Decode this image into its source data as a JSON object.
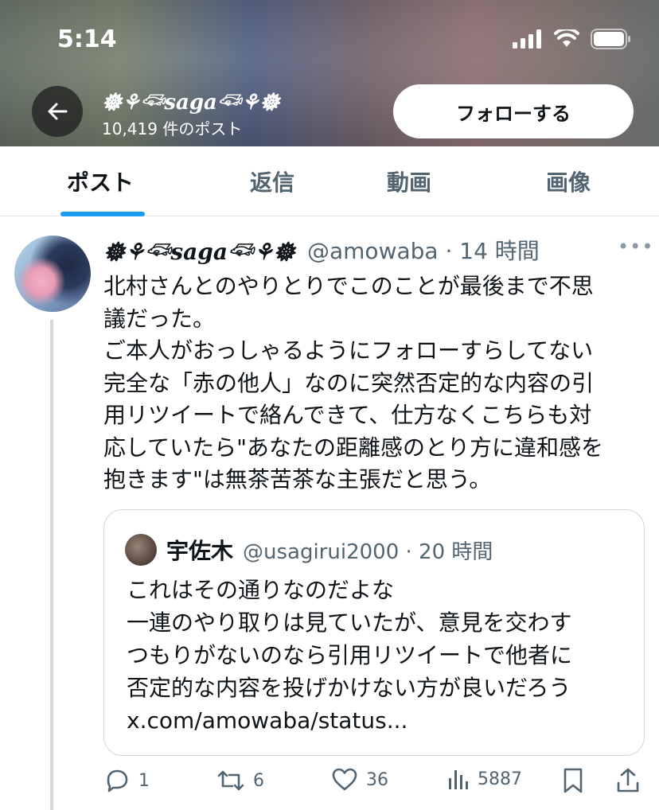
{
  "status_bar": {
    "time": "5:14"
  },
  "header": {
    "profile_name": "𖣔⚘𓆛saga𓆛⚘𖣔",
    "post_count": "10,419 件のポスト",
    "follow_label": "フォローする"
  },
  "tabs": [
    {
      "label": "ポスト",
      "active": true
    },
    {
      "label": "返信",
      "active": false
    },
    {
      "label": "動画",
      "active": false
    },
    {
      "label": "画像",
      "active": false
    }
  ],
  "tweet": {
    "name": "𖣔⚘𓆛saga𓆛⚘𖣔",
    "handle_time": "@amowaba · 14 時間",
    "more": "•••",
    "body": "北村さんとのやりとりでこのことが最後まで不思\n議だった。\nご本人がおっしゃるようにフォローすらしてない\n完全な「赤の他人」なのに突然否定的な内容の引\n用リツイートで絡んできて、仕方なくこちらも対\n応していたら\"あなたの距離感のとり方に違和感を\n抱きます\"は無茶苦茶な主張だと思う。"
  },
  "quote": {
    "name": "宇佐木",
    "handle_time": "@usagirui2000 · 20 時間",
    "body": "これはその通りなのだよな\n一連のやり取りは見ていたが、意見を交わす\nつもりがないのなら引用リツイートで他者に\n否定的な内容を投げかけない方が良いだろう\nx.com/amowaba/status..."
  },
  "actions": {
    "replies": "1",
    "retweets": "6",
    "likes": "36",
    "views": "5887"
  },
  "colors": {
    "accent": "#1d9bf0",
    "muted": "#536471"
  }
}
